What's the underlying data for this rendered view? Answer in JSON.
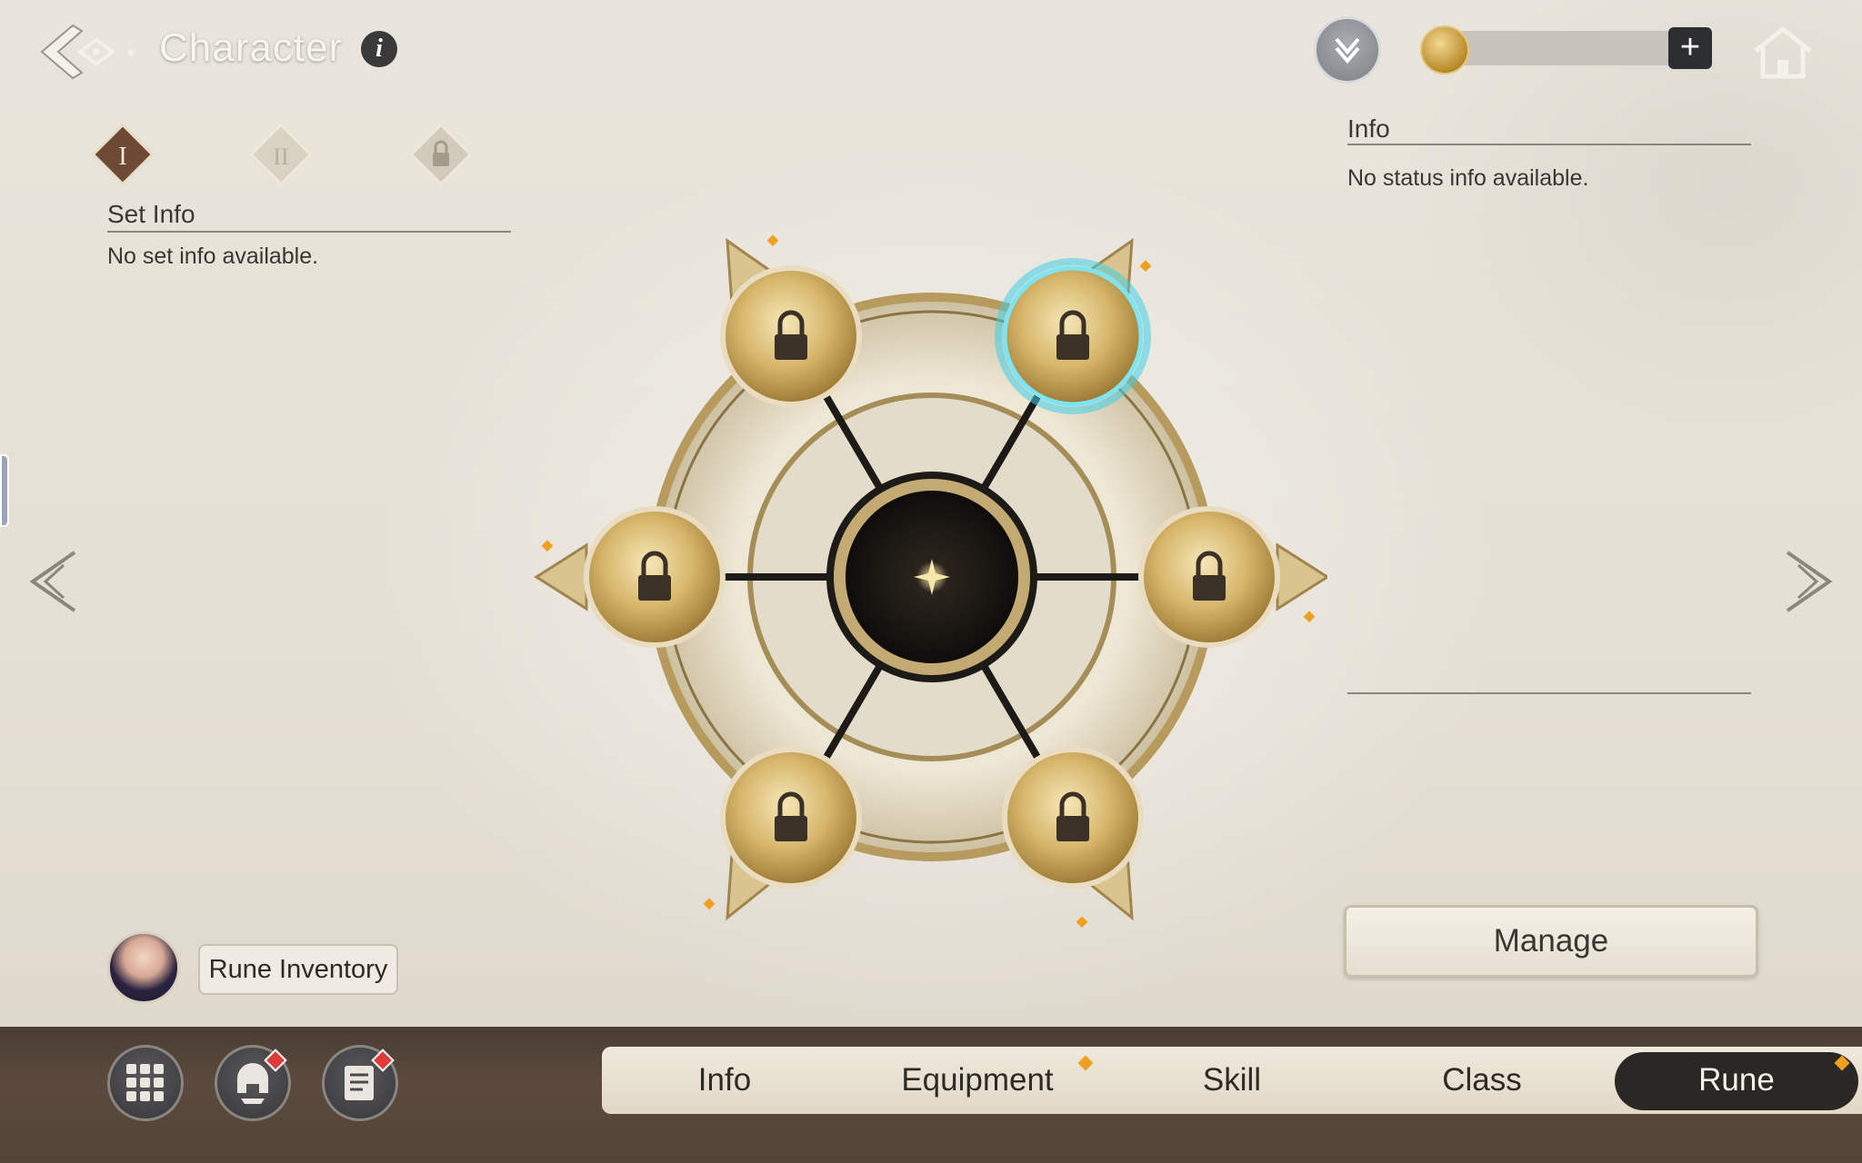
{
  "header": {
    "title": "Character",
    "info_glyph": "i",
    "currency": {
      "value": "",
      "add_label": "+"
    }
  },
  "set_info": {
    "title": "Set Info",
    "text": "No set info available.",
    "tier_labels": [
      "I",
      "II",
      ""
    ]
  },
  "status_info": {
    "title": "Info",
    "text": "No status info available."
  },
  "rune_wheel": {
    "slots": [
      {
        "name": "top-left",
        "state": "locked"
      },
      {
        "name": "top-right",
        "state": "locked",
        "selected": true
      },
      {
        "name": "left",
        "state": "locked"
      },
      {
        "name": "right",
        "state": "locked"
      },
      {
        "name": "bottom-left",
        "state": "locked"
      },
      {
        "name": "bottom-right",
        "state": "locked"
      }
    ]
  },
  "actions": {
    "manage_label": "Manage",
    "rune_inventory_label": "Rune Inventory"
  },
  "tabs": [
    {
      "label": "Info",
      "active": false,
      "has_dot": false
    },
    {
      "label": "Equipment",
      "active": false,
      "has_dot": true
    },
    {
      "label": "Skill",
      "active": false,
      "has_dot": false
    },
    {
      "label": "Class",
      "active": false,
      "has_dot": false
    },
    {
      "label": "Rune",
      "active": true,
      "has_dot": true
    }
  ],
  "bottom_icons": [
    "menu-grid-icon",
    "helmet-icon",
    "quest-scroll-icon"
  ],
  "colors": {
    "accent_gold": "#c9a24a",
    "selected_glow": "#3fd0e8",
    "active_tab": "#2a2725",
    "notification_dot": "#f0a020",
    "red_badge": "#e03a3a"
  }
}
